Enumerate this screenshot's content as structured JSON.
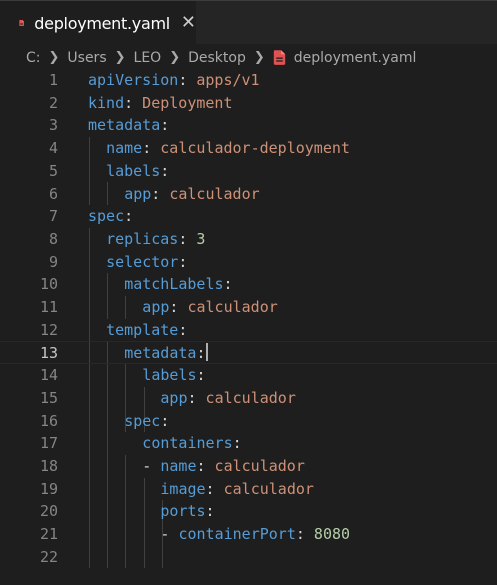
{
  "tab": {
    "label": "deployment.yaml",
    "icon": "yaml-file-icon",
    "icon_color": "#e05252"
  },
  "breadcrumb": {
    "items": [
      "C:",
      "Users",
      "LEO",
      "Desktop"
    ],
    "file": "deployment.yaml",
    "separator": ">"
  },
  "editor": {
    "active_line": "13",
    "lines": [
      {
        "num": "1",
        "key": "apiVersion",
        "colon": ":",
        "value": " apps/v1"
      },
      {
        "num": "2",
        "key": "kind",
        "colon": ":",
        "value": " Deployment"
      },
      {
        "num": "3",
        "key": "metadata",
        "colon": ":",
        "value": ""
      },
      {
        "num": "4",
        "key": "name",
        "colon": ":",
        "value": " calculador-deployment"
      },
      {
        "num": "5",
        "key": "labels",
        "colon": ":",
        "value": ""
      },
      {
        "num": "6",
        "key": "app",
        "colon": ":",
        "value": " calculador"
      },
      {
        "num": "7",
        "key": "spec",
        "colon": ":",
        "value": ""
      },
      {
        "num": "8",
        "key": "replicas",
        "colon": ":",
        "number": " 3"
      },
      {
        "num": "9",
        "key": "selector",
        "colon": ":",
        "value": ""
      },
      {
        "num": "10",
        "key": "matchLabels",
        "colon": ":",
        "value": ""
      },
      {
        "num": "11",
        "key": "app",
        "colon": ":",
        "value": " calculador"
      },
      {
        "num": "12",
        "key": "template",
        "colon": ":",
        "value": ""
      },
      {
        "num": "13",
        "key": "metadata",
        "colon": ":",
        "value": ""
      },
      {
        "num": "14",
        "key": "labels",
        "colon": ":",
        "value": ""
      },
      {
        "num": "15",
        "key": "app",
        "colon": ":",
        "value": " calculador"
      },
      {
        "num": "16",
        "key": "spec",
        "colon": ":",
        "value": ""
      },
      {
        "num": "17",
        "key": "containers",
        "colon": ":",
        "value": ""
      },
      {
        "num": "18",
        "dash": "- ",
        "key": "name",
        "colon": ":",
        "value": " calculador"
      },
      {
        "num": "19",
        "key": "image",
        "colon": ":",
        "value": " calculador"
      },
      {
        "num": "20",
        "key": "ports",
        "colon": ":",
        "value": ""
      },
      {
        "num": "21",
        "dash": "- ",
        "key": "containerPort",
        "colon": ":",
        "number": " 8080"
      },
      {
        "num": "22",
        "key": "",
        "colon": "",
        "value": ""
      }
    ]
  }
}
